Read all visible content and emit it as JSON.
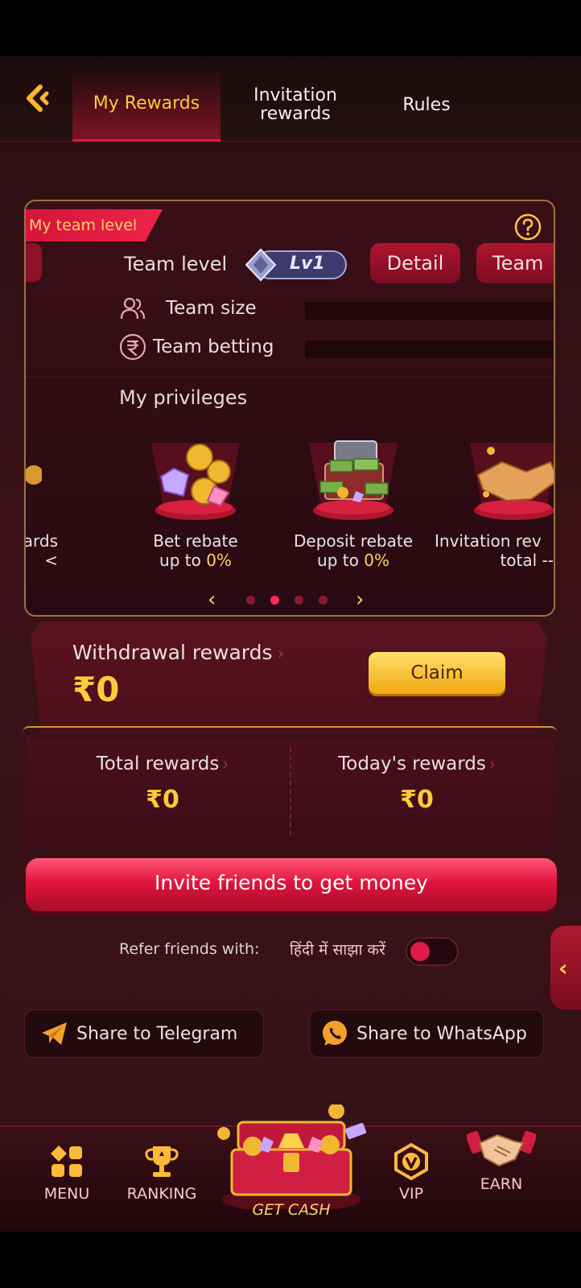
{
  "header": {
    "back_icon": "chevron-left-icon",
    "tabs": [
      {
        "label": "My Rewards",
        "active": true
      },
      {
        "label": "Invitation rewards",
        "active": false
      },
      {
        "label": "Rules",
        "active": false
      }
    ]
  },
  "team": {
    "ribbon": "My team level",
    "team_level_label": "Team level",
    "level_badge": "Lv1",
    "detail_label": "Detail",
    "team_label": "Team",
    "team_size_label": "Team size",
    "team_betting_label": "Team betting",
    "privileges_title": "My privileges",
    "privileges": [
      {
        "label": "vards",
        "sub": "<",
        "sub_value": ""
      },
      {
        "label": "Bet rebate",
        "sub": "up to ",
        "sub_value": "0%"
      },
      {
        "label": "Deposit rebate",
        "sub": "up to ",
        "sub_value": "0%"
      },
      {
        "label": "Invitation rev",
        "sub": "total --",
        "sub_value": ""
      }
    ],
    "carousel": {
      "prev": "‹",
      "next": "›",
      "pages": 4,
      "active_page": 2
    }
  },
  "withdraw": {
    "title": "Withdrawal rewards",
    "amount": "₹0",
    "claim_label": "Claim"
  },
  "rewards": {
    "total_label": "Total rewards",
    "total_value": "₹0",
    "today_label": "Today's rewards",
    "today_value": "₹0"
  },
  "invite_button": "Invite friends to get money",
  "refer": {
    "label": "Refer friends with:",
    "hindi": "हिंदी में साझा करें",
    "toggle_on": false
  },
  "share": {
    "telegram": "Share to Telegram",
    "whatsapp": "Share to WhatsApp"
  },
  "nav": {
    "menu": "MENU",
    "ranking": "RANKING",
    "get_cash": "GET CASH",
    "vip": "VIP",
    "earn": "EARN"
  },
  "colors": {
    "accent_gold": "#ffc93a",
    "accent_red": "#e01a4a",
    "background": "#2a0e12"
  }
}
